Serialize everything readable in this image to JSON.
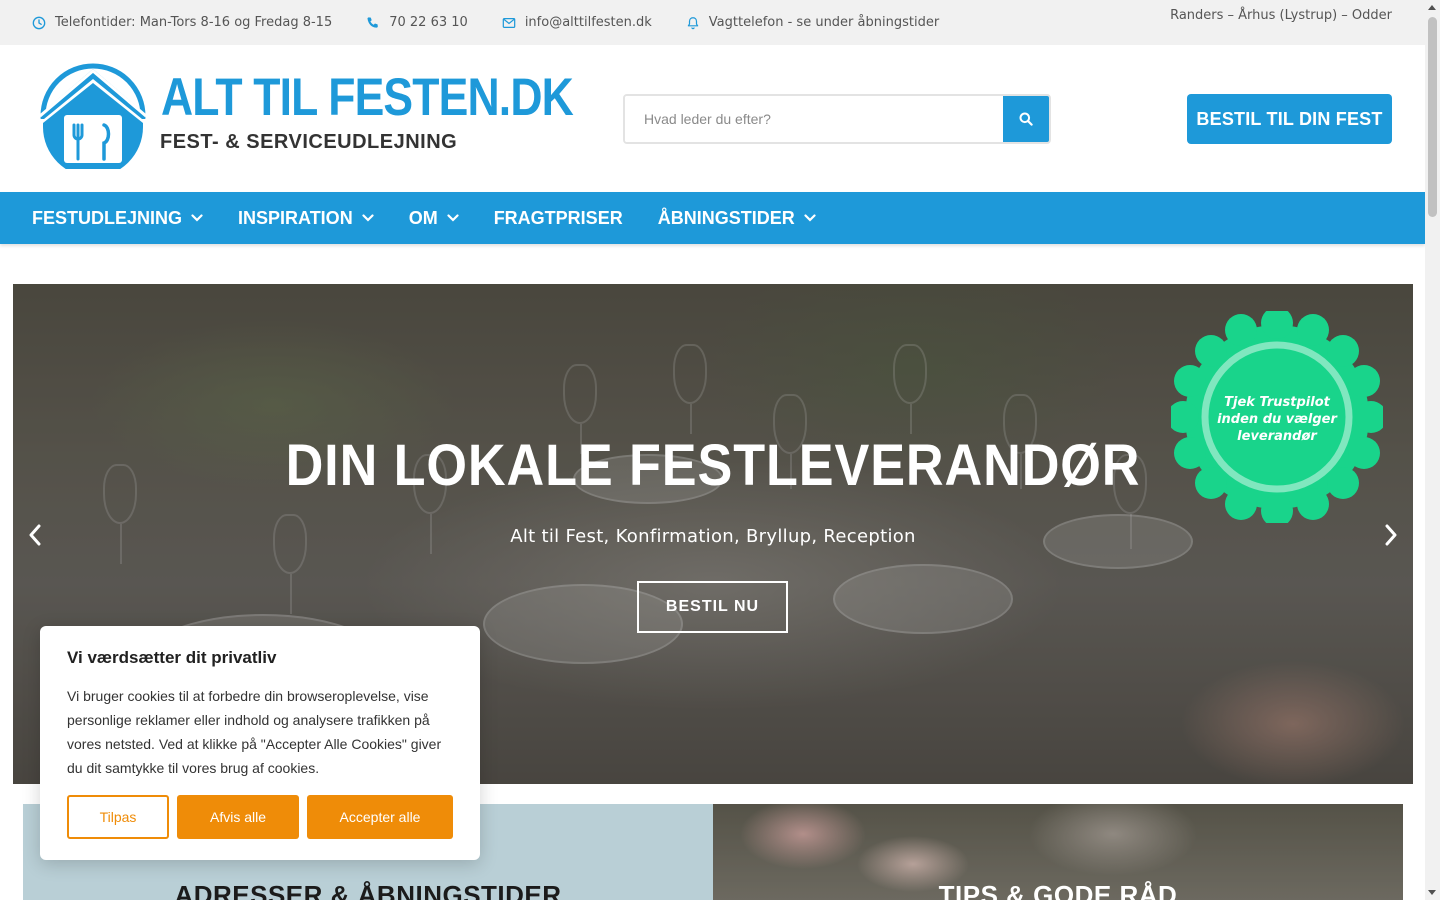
{
  "topbar": {
    "phone_hours": "Telefontider: Man-Tors 8-16 og Fredag 8-15",
    "phone": "70 22 63 10",
    "email": "info@alttilfesten.dk",
    "emergency": "Vagttelefon - se under åbningstider",
    "locations": "Randers – Århus (Lystrup) – Odder"
  },
  "header": {
    "logo_brand": "ALT TIL FESTEN.DK",
    "logo_tagline": "FEST- & SERVICEUDLEJNING",
    "search_placeholder": "Hvad leder du efter?",
    "cta_label": "BESTIL TIL DIN FEST"
  },
  "nav": {
    "items": [
      {
        "label": "FESTUDLEJNING",
        "has_dropdown": true
      },
      {
        "label": "INSPIRATION",
        "has_dropdown": true
      },
      {
        "label": "OM",
        "has_dropdown": true
      },
      {
        "label": "FRAGTPRISER",
        "has_dropdown": false
      },
      {
        "label": "ÅBNINGSTIDER",
        "has_dropdown": true
      }
    ]
  },
  "hero": {
    "headline": "DIN LOKALE FESTLEVERANDØR",
    "subheadline": "Alt til Fest, Konfirmation, Bryllup, Reception",
    "button_label": "BESTIL NU",
    "badge_text": "Tjek Trustpilot inden du vælger leverandør"
  },
  "tiles": {
    "left_title": "ADRESSER & ÅBNINGSTIDER",
    "right_title": "TIPS & GODE RÅD"
  },
  "cookie": {
    "title": "Vi værdsætter dit privatliv",
    "text": "Vi bruger cookies til at forbedre din browseroplevelse, vise personlige reklamer eller indhold og analysere trafikken på vores netsted. Ved at klikke på \"Accepter Alle Cookies\" giver du dit samtykke til vores brug af cookies.",
    "customize_label": "Tilpas",
    "reject_label": "Afvis alle",
    "accept_label": "Accepter alle"
  },
  "colors": {
    "brand_blue": "#1e99d9",
    "cookie_orange": "#ef8c08",
    "trustpilot_green": "#19d48b",
    "topbar_bg": "#f1f1f1"
  },
  "icons": {
    "phone_hours": "clock-icon",
    "phone": "phone-icon",
    "email": "envelope-icon",
    "emergency": "bell-icon",
    "search": "search-icon",
    "dropdown": "chevron-down-icon",
    "slider_prev": "chevron-left-icon",
    "slider_next": "chevron-right-icon"
  }
}
